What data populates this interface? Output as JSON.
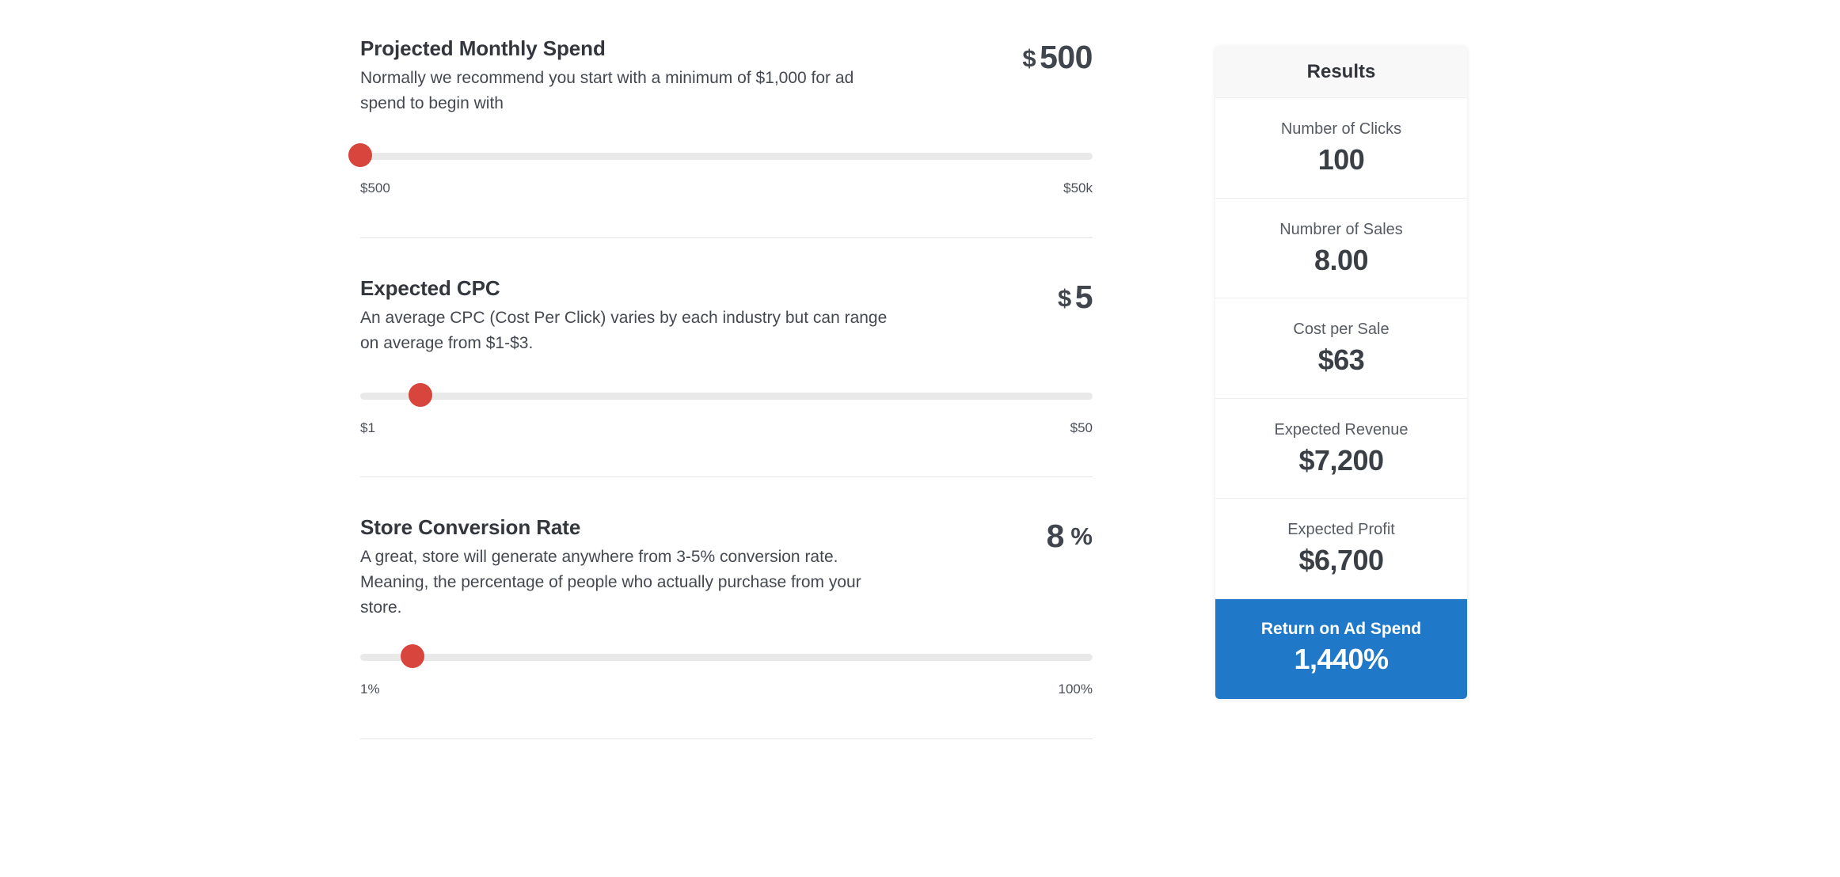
{
  "sliders": [
    {
      "title": "Projected Monthly Spend",
      "description": "Normally we recommend you start with a minimum of $1,000 for ad spend to begin with",
      "value_prefix": "$",
      "value_number": "500",
      "value_suffix": "",
      "min_label": "$500",
      "max_label": "$50k",
      "handle_percent": 0
    },
    {
      "title": "Expected CPC",
      "description": "An average CPC (Cost Per Click) varies by each industry but can range on average from $1-$3.",
      "value_prefix": "$",
      "value_number": "5",
      "value_suffix": "",
      "min_label": "$1",
      "max_label": "$50",
      "handle_percent": 8.2
    },
    {
      "title": "Store Conversion Rate",
      "description": "A great, store will generate anywhere from 3-5% conversion rate. Meaning, the percentage of people who actually purchase from your store.",
      "value_prefix": "",
      "value_number": "8",
      "value_suffix": "%",
      "min_label": "1%",
      "max_label": "100%",
      "handle_percent": 7.1
    }
  ],
  "results": {
    "title": "Results",
    "rows": [
      {
        "label": "Number of Clicks",
        "value": "100"
      },
      {
        "label": "Numbrer of Sales",
        "value": "8.00"
      },
      {
        "label": "Cost per Sale",
        "value": "$63"
      },
      {
        "label": "Expected Revenue",
        "value": "$7,200"
      },
      {
        "label": "Expected Profit",
        "value": "$6,700"
      }
    ],
    "roas": {
      "label": "Return on Ad Spend",
      "value": "1,440%"
    }
  },
  "colors": {
    "slider_handle": "#d7453c",
    "slider_track": "#e9e9e9",
    "roas_background": "#1f78c8",
    "panel_header_background": "#f8f8f8"
  }
}
